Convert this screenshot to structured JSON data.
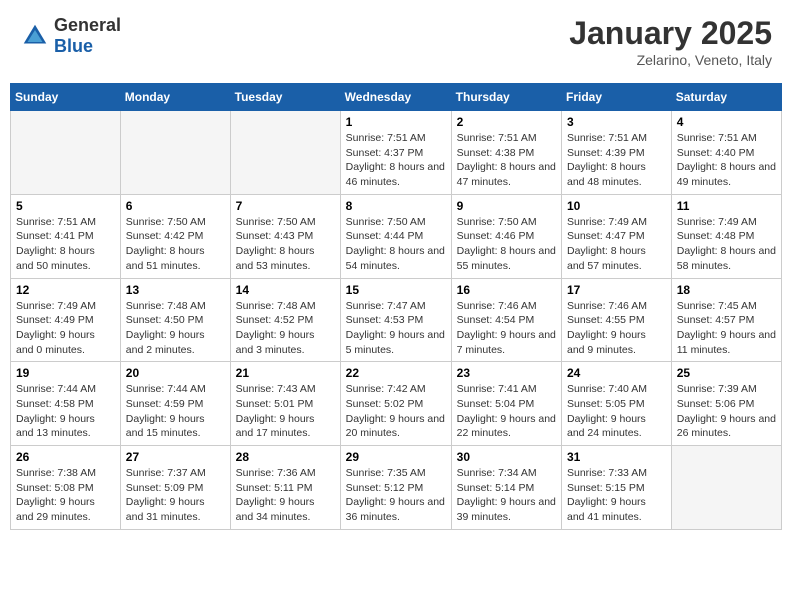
{
  "header": {
    "logo_general": "General",
    "logo_blue": "Blue",
    "month": "January 2025",
    "location": "Zelarino, Veneto, Italy"
  },
  "weekdays": [
    "Sunday",
    "Monday",
    "Tuesday",
    "Wednesday",
    "Thursday",
    "Friday",
    "Saturday"
  ],
  "weeks": [
    [
      {
        "day": "",
        "info": ""
      },
      {
        "day": "",
        "info": ""
      },
      {
        "day": "",
        "info": ""
      },
      {
        "day": "1",
        "info": "Sunrise: 7:51 AM\nSunset: 4:37 PM\nDaylight: 8 hours and 46 minutes."
      },
      {
        "day": "2",
        "info": "Sunrise: 7:51 AM\nSunset: 4:38 PM\nDaylight: 8 hours and 47 minutes."
      },
      {
        "day": "3",
        "info": "Sunrise: 7:51 AM\nSunset: 4:39 PM\nDaylight: 8 hours and 48 minutes."
      },
      {
        "day": "4",
        "info": "Sunrise: 7:51 AM\nSunset: 4:40 PM\nDaylight: 8 hours and 49 minutes."
      }
    ],
    [
      {
        "day": "5",
        "info": "Sunrise: 7:51 AM\nSunset: 4:41 PM\nDaylight: 8 hours and 50 minutes."
      },
      {
        "day": "6",
        "info": "Sunrise: 7:50 AM\nSunset: 4:42 PM\nDaylight: 8 hours and 51 minutes."
      },
      {
        "day": "7",
        "info": "Sunrise: 7:50 AM\nSunset: 4:43 PM\nDaylight: 8 hours and 53 minutes."
      },
      {
        "day": "8",
        "info": "Sunrise: 7:50 AM\nSunset: 4:44 PM\nDaylight: 8 hours and 54 minutes."
      },
      {
        "day": "9",
        "info": "Sunrise: 7:50 AM\nSunset: 4:46 PM\nDaylight: 8 hours and 55 minutes."
      },
      {
        "day": "10",
        "info": "Sunrise: 7:49 AM\nSunset: 4:47 PM\nDaylight: 8 hours and 57 minutes."
      },
      {
        "day": "11",
        "info": "Sunrise: 7:49 AM\nSunset: 4:48 PM\nDaylight: 8 hours and 58 minutes."
      }
    ],
    [
      {
        "day": "12",
        "info": "Sunrise: 7:49 AM\nSunset: 4:49 PM\nDaylight: 9 hours and 0 minutes."
      },
      {
        "day": "13",
        "info": "Sunrise: 7:48 AM\nSunset: 4:50 PM\nDaylight: 9 hours and 2 minutes."
      },
      {
        "day": "14",
        "info": "Sunrise: 7:48 AM\nSunset: 4:52 PM\nDaylight: 9 hours and 3 minutes."
      },
      {
        "day": "15",
        "info": "Sunrise: 7:47 AM\nSunset: 4:53 PM\nDaylight: 9 hours and 5 minutes."
      },
      {
        "day": "16",
        "info": "Sunrise: 7:46 AM\nSunset: 4:54 PM\nDaylight: 9 hours and 7 minutes."
      },
      {
        "day": "17",
        "info": "Sunrise: 7:46 AM\nSunset: 4:55 PM\nDaylight: 9 hours and 9 minutes."
      },
      {
        "day": "18",
        "info": "Sunrise: 7:45 AM\nSunset: 4:57 PM\nDaylight: 9 hours and 11 minutes."
      }
    ],
    [
      {
        "day": "19",
        "info": "Sunrise: 7:44 AM\nSunset: 4:58 PM\nDaylight: 9 hours and 13 minutes."
      },
      {
        "day": "20",
        "info": "Sunrise: 7:44 AM\nSunset: 4:59 PM\nDaylight: 9 hours and 15 minutes."
      },
      {
        "day": "21",
        "info": "Sunrise: 7:43 AM\nSunset: 5:01 PM\nDaylight: 9 hours and 17 minutes."
      },
      {
        "day": "22",
        "info": "Sunrise: 7:42 AM\nSunset: 5:02 PM\nDaylight: 9 hours and 20 minutes."
      },
      {
        "day": "23",
        "info": "Sunrise: 7:41 AM\nSunset: 5:04 PM\nDaylight: 9 hours and 22 minutes."
      },
      {
        "day": "24",
        "info": "Sunrise: 7:40 AM\nSunset: 5:05 PM\nDaylight: 9 hours and 24 minutes."
      },
      {
        "day": "25",
        "info": "Sunrise: 7:39 AM\nSunset: 5:06 PM\nDaylight: 9 hours and 26 minutes."
      }
    ],
    [
      {
        "day": "26",
        "info": "Sunrise: 7:38 AM\nSunset: 5:08 PM\nDaylight: 9 hours and 29 minutes."
      },
      {
        "day": "27",
        "info": "Sunrise: 7:37 AM\nSunset: 5:09 PM\nDaylight: 9 hours and 31 minutes."
      },
      {
        "day": "28",
        "info": "Sunrise: 7:36 AM\nSunset: 5:11 PM\nDaylight: 9 hours and 34 minutes."
      },
      {
        "day": "29",
        "info": "Sunrise: 7:35 AM\nSunset: 5:12 PM\nDaylight: 9 hours and 36 minutes."
      },
      {
        "day": "30",
        "info": "Sunrise: 7:34 AM\nSunset: 5:14 PM\nDaylight: 9 hours and 39 minutes."
      },
      {
        "day": "31",
        "info": "Sunrise: 7:33 AM\nSunset: 5:15 PM\nDaylight: 9 hours and 41 minutes."
      },
      {
        "day": "",
        "info": ""
      }
    ]
  ]
}
